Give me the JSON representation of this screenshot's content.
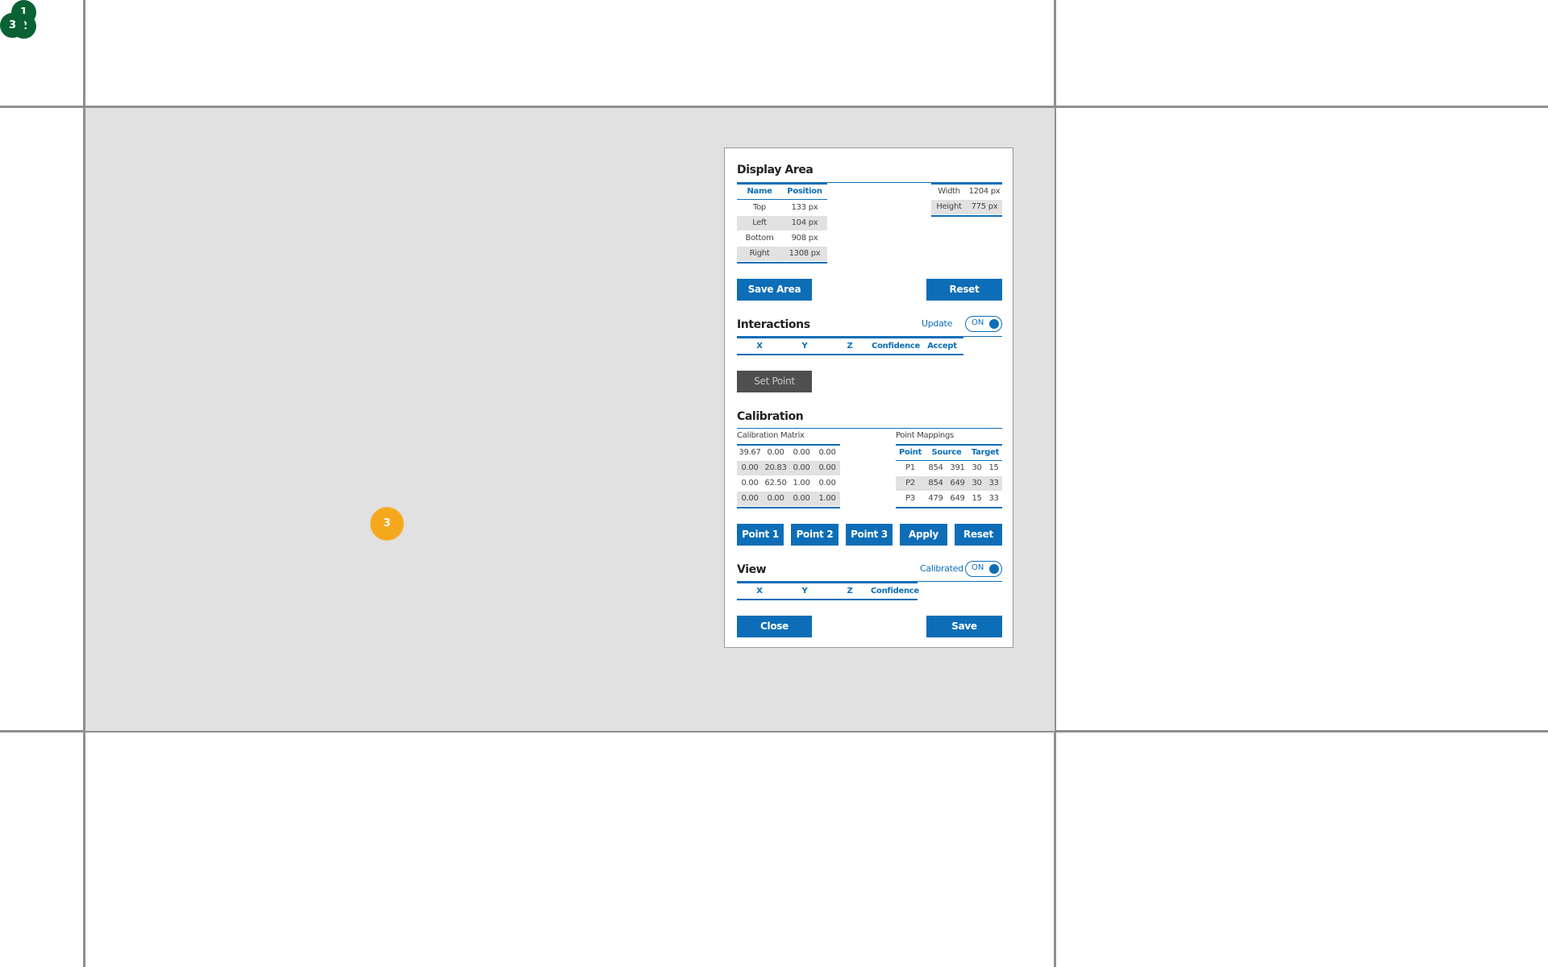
{
  "markers": {
    "green": [
      "1",
      "2",
      "3"
    ],
    "orange": "3"
  },
  "display_area": {
    "title": "Display Area",
    "columns": [
      "Name",
      "Position"
    ],
    "rows": [
      {
        "name": "Top",
        "position": "133 px"
      },
      {
        "name": "Left",
        "position": "104 px"
      },
      {
        "name": "Bottom",
        "position": "908 px"
      },
      {
        "name": "Right",
        "position": "1308 px"
      }
    ],
    "size": [
      {
        "name": "Width",
        "value": "1204 px"
      },
      {
        "name": "Height",
        "value": "775 px"
      }
    ],
    "save_label": "Save Area",
    "reset_label": "Reset"
  },
  "interactions": {
    "title": "Interactions",
    "update_label": "Update",
    "update_toggle": "ON",
    "columns": [
      "X",
      "Y",
      "Z",
      "Confidence",
      "Accept"
    ],
    "set_point_label": "Set Point"
  },
  "calibration": {
    "title": "Calibration",
    "matrix_label": "Calibration Matrix",
    "matrix": [
      [
        "39.67",
        "0.00",
        "0.00",
        "0.00"
      ],
      [
        "0.00",
        "20.83",
        "0.00",
        "0.00"
      ],
      [
        "0.00",
        "62.50",
        "1.00",
        "0.00"
      ],
      [
        "0.00",
        "0.00",
        "0.00",
        "1.00"
      ]
    ],
    "mappings_label": "Point Mappings",
    "mapping_columns": [
      "Point",
      "Source",
      "Target"
    ],
    "mappings": [
      [
        "P1",
        "854",
        "391",
        "30",
        "15"
      ],
      [
        "P2",
        "854",
        "649",
        "30",
        "33"
      ],
      [
        "P3",
        "479",
        "649",
        "15",
        "33"
      ]
    ],
    "buttons": [
      "Point 1",
      "Point 2",
      "Point 3",
      "Apply",
      "Reset"
    ]
  },
  "view": {
    "title": "View",
    "calibrated_label": "Calibrated",
    "calibrated_toggle": "ON",
    "columns": [
      "X",
      "Y",
      "Z",
      "Confidence"
    ],
    "close_label": "Close",
    "save_label": "Save"
  },
  "colors": {
    "accent": "#0d6eb7",
    "marker_green": "#0a6234",
    "marker_orange": "#f6a81c",
    "display_bg": "#e1e1e1"
  }
}
